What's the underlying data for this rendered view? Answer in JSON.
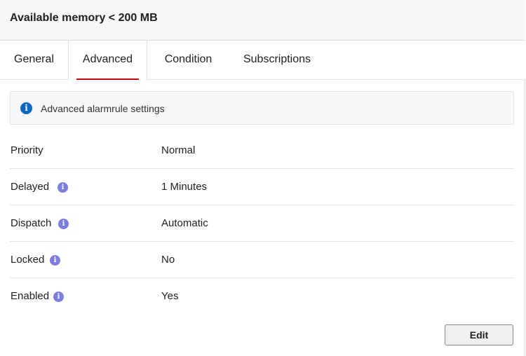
{
  "header": {
    "title": "Available memory < 200 MB"
  },
  "tabs": [
    {
      "label": "General",
      "active": false
    },
    {
      "label": "Advanced",
      "active": true
    },
    {
      "label": "Condition",
      "active": false
    },
    {
      "label": "Subscriptions",
      "active": false
    }
  ],
  "banner": {
    "icon": "info-icon",
    "text": "Advanced alarmrule settings"
  },
  "settings": [
    {
      "label": "Priority",
      "value": "Normal",
      "has_info": false
    },
    {
      "label": "Delayed",
      "value": "1 Minutes",
      "has_info": true
    },
    {
      "label": "Dispatch",
      "value": "Automatic",
      "has_info": true
    },
    {
      "label": "Locked",
      "value": "No",
      "has_info": true
    },
    {
      "label": "Enabled",
      "value": "Yes",
      "has_info": true
    }
  ],
  "actions": {
    "edit_label": "Edit"
  },
  "colors": {
    "accent": "#cc0000",
    "banner_icon": "#0b67c2",
    "info_icon": "#7a7ee0"
  }
}
